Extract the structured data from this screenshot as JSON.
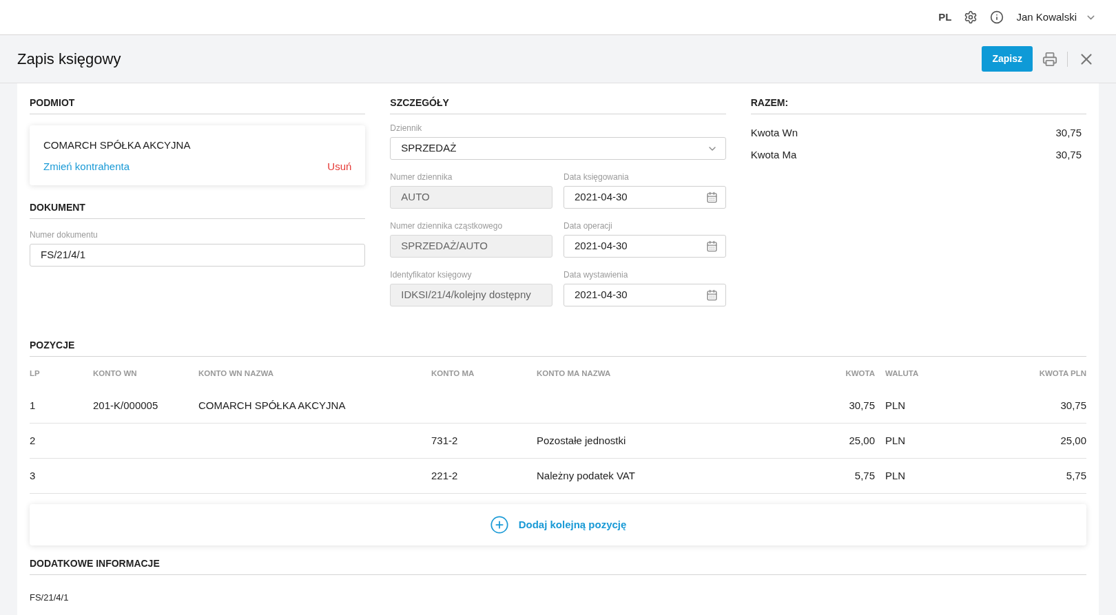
{
  "topbar": {
    "language": "PL",
    "user": "Jan Kowalski"
  },
  "header": {
    "title": "Zapis księgowy",
    "save_button": "Zapisz"
  },
  "podmiot": {
    "heading": "PODMIOT",
    "name": "COMARCH SPÓŁKA AKCYJNA",
    "change_link": "Zmień kontrahenta",
    "remove_link": "Usuń"
  },
  "dokument": {
    "heading": "DOKUMENT",
    "field": {
      "label": "Numer dokumentu",
      "value": "FS/21/4/1",
      "disabled": false
    }
  },
  "szczegoly": {
    "heading": "SZCZEGÓŁY",
    "journal": {
      "label": "Dziennik",
      "value": "SPRZEDAŻ",
      "kind": "select",
      "disabled": false
    },
    "fields": [
      {
        "label": "Numer dziennika",
        "value": "AUTO",
        "kind": "text",
        "disabled": true
      },
      {
        "label": "Data księgowania",
        "value": "2021-04-30",
        "kind": "date",
        "disabled": false
      },
      {
        "label": "Numer dziennika cząstkowego",
        "value": "SPRZEDAŻ/AUTO",
        "kind": "text",
        "disabled": true
      },
      {
        "label": "Data operacji",
        "value": "2021-04-30",
        "kind": "date",
        "disabled": false
      },
      {
        "label": "Identyfikator księgowy",
        "value": "IDKSI/21/4/kolejny dostępny",
        "kind": "text",
        "disabled": true
      },
      {
        "label": "Data wystawienia",
        "value": "2021-04-30",
        "kind": "date",
        "disabled": false
      }
    ]
  },
  "razem": {
    "heading": "RAZEM:",
    "rows": [
      {
        "label": "Kwota Wn",
        "value": "30,75"
      },
      {
        "label": "Kwota Ma",
        "value": "30,75"
      }
    ]
  },
  "pozycje": {
    "heading": "POZYCJE",
    "columns": [
      "LP",
      "KONTO WN",
      "KONTO WN NAZWA",
      "KONTO MA",
      "KONTO MA NAZWA",
      "KWOTA",
      "WALUTA",
      "KWOTA PLN"
    ],
    "rows": [
      [
        "1",
        "201-K/000005",
        "COMARCH SPÓŁKA AKCYJNA",
        "",
        "",
        "30,75",
        "PLN",
        "30,75"
      ],
      [
        "2",
        "",
        "",
        "731-2",
        "Pozostałe jednostki",
        "25,00",
        "PLN",
        "25,00"
      ],
      [
        "3",
        "",
        "",
        "221-2",
        "Należny podatek VAT",
        "5,75",
        "PLN",
        "5,75"
      ]
    ],
    "add_button": "Dodaj kolejną pozycję"
  },
  "dodatkowe": {
    "heading": "DODATKOWE INFORMACJE",
    "text": "FS/21/4/1"
  }
}
